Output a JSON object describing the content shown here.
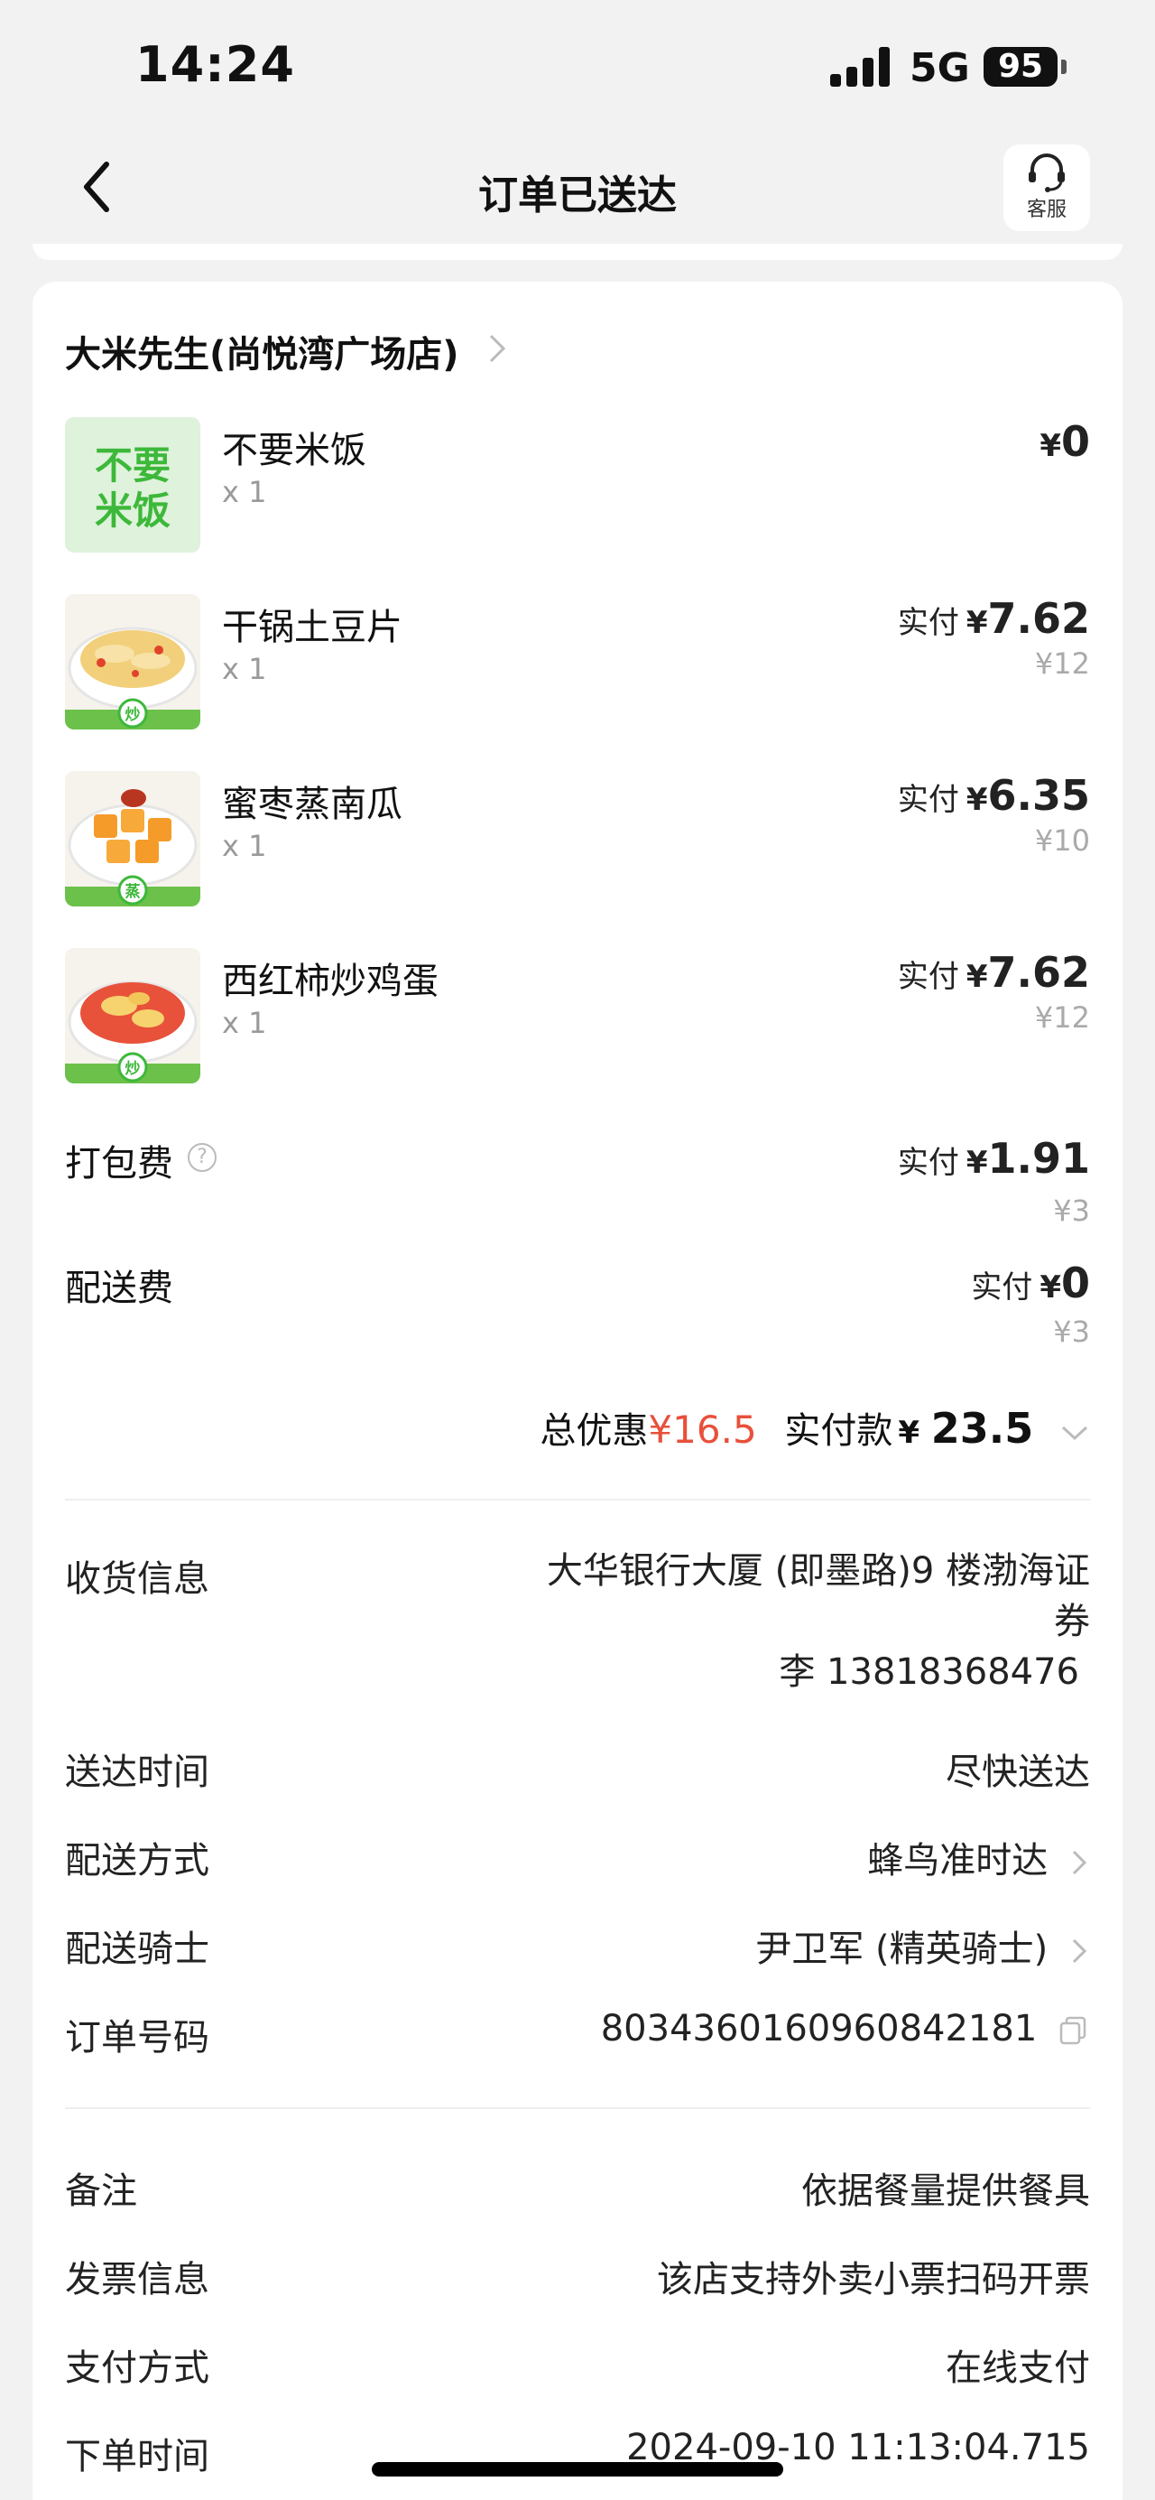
{
  "status_bar": {
    "time": "14:24",
    "network": "5G",
    "battery": "95"
  },
  "nav": {
    "title": "订单已送达",
    "service_label": "客服"
  },
  "shop": {
    "name": "大米先生(尚悦湾广场店)"
  },
  "items": [
    {
      "name": "不要米饭",
      "qty": "x 1",
      "paid_prefix": "",
      "currency": "¥",
      "paid": "0",
      "original": "",
      "thumb_text": [
        "不要",
        "米饭"
      ]
    },
    {
      "name": "干锅土豆片",
      "qty": "x 1",
      "paid_prefix": "实付",
      "currency": "¥",
      "paid": "7.62",
      "original": "¥12",
      "badge": "炒"
    },
    {
      "name": "蜜枣蒸南瓜",
      "qty": "x 1",
      "paid_prefix": "实付",
      "currency": "¥",
      "paid": "6.35",
      "original": "¥10",
      "badge": "蒸"
    },
    {
      "name": "西红柿炒鸡蛋",
      "qty": "x 1",
      "paid_prefix": "实付",
      "currency": "¥",
      "paid": "7.62",
      "original": "¥12",
      "badge": "炒"
    }
  ],
  "fees": {
    "packing": {
      "label": "打包费",
      "help": "?",
      "paid_prefix": "实付",
      "currency": "¥",
      "paid": "1.91",
      "original": "¥3"
    },
    "delivery": {
      "label": "配送费",
      "paid_prefix": "实付",
      "currency": "¥",
      "paid": "0",
      "original": "¥3"
    }
  },
  "totals": {
    "discount_label": "总优惠",
    "discount_value": "¥16.5",
    "paid_label": "实付款",
    "currency": "¥",
    "paid_value": "23.5"
  },
  "delivery_info": {
    "receiver_label": "收货信息",
    "address_line1": "大华银行大厦 (即墨路)9 楼渤海证",
    "address_line2": "券",
    "contact": "李 13818368476",
    "time_label": "送达时间",
    "time_value": "尽快送达",
    "method_label": "配送方式",
    "method_value": "蜂鸟准时达",
    "rider_label": "配送骑士",
    "rider_value": "尹卫军 (精英骑士)",
    "order_no_label": "订单号码",
    "order_no_value": "8034360160960842181"
  },
  "order_info": {
    "remark_label": "备注",
    "remark_value": "依据餐量提供餐具",
    "invoice_label": "发票信息",
    "invoice_value": "该店支持外卖小票扫码开票",
    "payment_label": "支付方式",
    "payment_value": "在线支付",
    "order_time_label": "下单时间",
    "order_time_value": "2024-09-10 11:13:04.715"
  },
  "colors": {
    "accent_green": "#3db83a",
    "discount_red": "#e8503b",
    "background": "#f2f2f2"
  }
}
